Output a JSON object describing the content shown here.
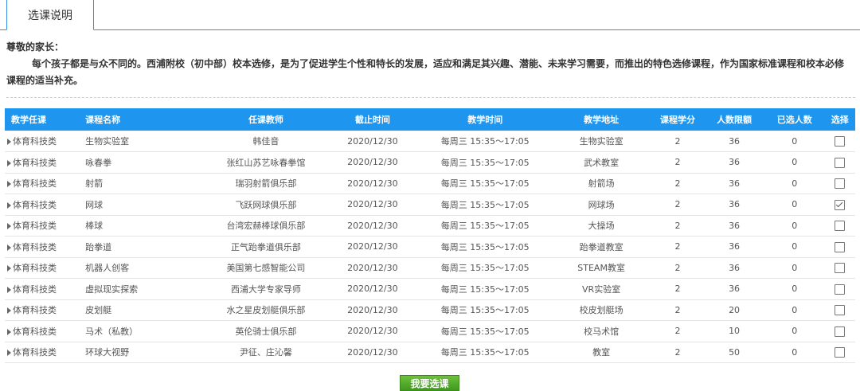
{
  "tab": {
    "label": "选课说明"
  },
  "intro": {
    "greeting": "尊敬的家长：",
    "paragraph": "每个孩子都是与众不同的。西浦附校（初中部）校本选修，是为了促进学生个性和特长的发展，适应和满足其兴趣、潜能、未来学习需要，而推出的特色选修课程，作为国家标准课程和校本必修课程的适当补充。"
  },
  "table": {
    "headers": [
      "教学任课",
      "课程名称",
      "任课教师",
      "截止时间",
      "教学时间",
      "教学地址",
      "课程学分",
      "人数限额",
      "已选人数",
      "选择"
    ],
    "rows": [
      {
        "category": "体育科技类",
        "course": "生物实验室",
        "teacher": "韩佳音",
        "deadline": "2020/12/30",
        "time": "每周三 15:35～17:05",
        "location": "生物实验室",
        "credit": "2",
        "limit": "36",
        "selected": "0",
        "checked": false
      },
      {
        "category": "体育科技类",
        "course": "咏春拳",
        "teacher": "张红山苏艺咏春拳馆",
        "deadline": "2020/12/30",
        "time": "每周三 15:35～17:05",
        "location": "武术教室",
        "credit": "2",
        "limit": "36",
        "selected": "0",
        "checked": false
      },
      {
        "category": "体育科技类",
        "course": "射箭",
        "teacher": "瑞羽射箭俱乐部",
        "deadline": "2020/12/30",
        "time": "每周三 15:35～17:05",
        "location": "射箭场",
        "credit": "2",
        "limit": "36",
        "selected": "0",
        "checked": false
      },
      {
        "category": "体育科技类",
        "course": "网球",
        "teacher": "飞跃网球俱乐部",
        "deadline": "2020/12/30",
        "time": "每周三 15:35～17:05",
        "location": "网球场",
        "credit": "2",
        "limit": "36",
        "selected": "0",
        "checked": true
      },
      {
        "category": "体育科技类",
        "course": "棒球",
        "teacher": "台湾宏赫棒球俱乐部",
        "deadline": "2020/12/30",
        "time": "每周三 15:35～17:05",
        "location": "大操场",
        "credit": "2",
        "limit": "36",
        "selected": "0",
        "checked": false
      },
      {
        "category": "体育科技类",
        "course": "跆拳道",
        "teacher": "正气跆拳道俱乐部",
        "deadline": "2020/12/30",
        "time": "每周三 15:35～17:05",
        "location": "跆拳道教室",
        "credit": "2",
        "limit": "36",
        "selected": "0",
        "checked": false
      },
      {
        "category": "体育科技类",
        "course": "机器人创客",
        "teacher": "美国第七感智能公司",
        "deadline": "2020/12/30",
        "time": "每周三 15:35～17:05",
        "location": "STEAM教室",
        "credit": "2",
        "limit": "36",
        "selected": "0",
        "checked": false
      },
      {
        "category": "体育科技类",
        "course": "虚拟现实探索",
        "teacher": "西浦大学专家导师",
        "deadline": "2020/12/30",
        "time": "每周三 15:35～17:05",
        "location": "VR实验室",
        "credit": "2",
        "limit": "36",
        "selected": "0",
        "checked": false
      },
      {
        "category": "体育科技类",
        "course": "皮划艇",
        "teacher": "水之星皮划艇俱乐部",
        "deadline": "2020/12/30",
        "time": "每周三 15:35～17:05",
        "location": "校皮划艇场",
        "credit": "2",
        "limit": "20",
        "selected": "0",
        "checked": false
      },
      {
        "category": "体育科技类",
        "course": "马术（私教）",
        "teacher": "英伦骑士俱乐部",
        "deadline": "2020/12/30",
        "time": "每周三 15:35～17:05",
        "location": "校马术馆",
        "credit": "2",
        "limit": "10",
        "selected": "0",
        "checked": false
      },
      {
        "category": "体育科技类",
        "course": "环球大视野",
        "teacher": "尹征、庄沁馨",
        "deadline": "2020/12/30",
        "time": "每周三 15:35～17:05",
        "location": "教室",
        "credit": "2",
        "limit": "50",
        "selected": "0",
        "checked": false
      }
    ]
  },
  "actions": {
    "submit_label": "我要选课"
  },
  "colors": {
    "header_bg": "#1e96f0",
    "tab_border": "#3a8ee6",
    "submit_bg": "#4fa82a"
  }
}
